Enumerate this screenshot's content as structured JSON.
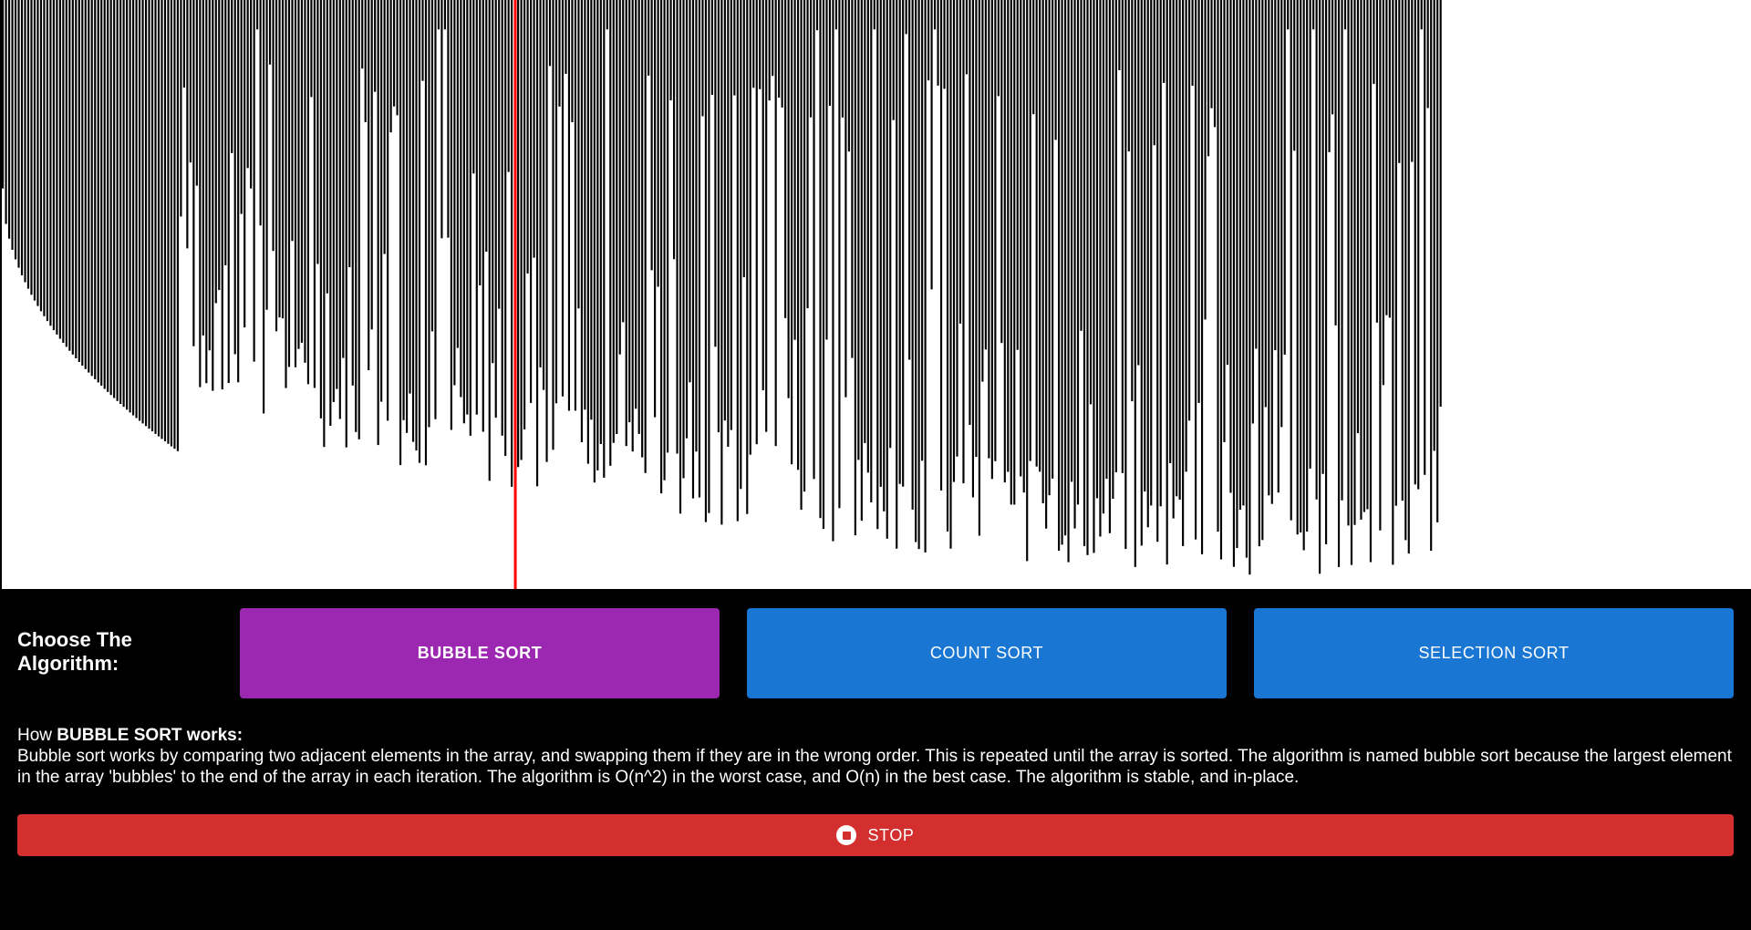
{
  "colors": {
    "background": "#000000",
    "bar": "#000000",
    "bar_area": "#ffffff",
    "highlight_bar": "#ff0000",
    "active_algorithm": "#9c27b0",
    "algorithm_button": "#1976d2",
    "stop_button": "#d32f2f"
  },
  "visualizer": {
    "bar_count": 500,
    "sorted_prefix_count": 56,
    "highlight_index": 161,
    "empty_suffix_count": 47,
    "noise_seed": 7,
    "deep_gap_indices": [
      33,
      80,
      137,
      139,
      190,
      256,
      262,
      274,
      284,
      293,
      404,
      412,
      422,
      446,
      469
    ]
  },
  "controls": {
    "choose_label": "Choose The Algorithm:",
    "algorithms": [
      {
        "label": "BUBBLE SORT",
        "active": true
      },
      {
        "label": "COUNT SORT",
        "active": false
      },
      {
        "label": "SELECTION SORT",
        "active": false
      }
    ]
  },
  "description": {
    "prefix": "How ",
    "algorithm_name": "BUBBLE SORT works:",
    "body": "Bubble sort works by comparing two adjacent elements in the array, and swapping them if they are in the wrong order. This is repeated until the array is sorted. The algorithm is named bubble sort because the largest element in the array 'bubbles' to the end of the array in each iteration. The algorithm is O(n^2) in the worst case, and O(n) in the best case. The algorithm is stable, and in-place."
  },
  "stop_button": {
    "label": "STOP",
    "icon": "stop-circle-icon"
  }
}
